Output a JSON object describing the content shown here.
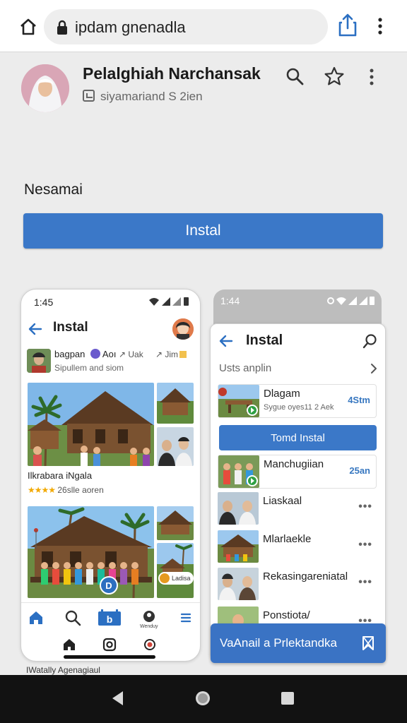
{
  "browser": {
    "url": "ipdam gnenadla",
    "icons": {
      "home": "home-icon",
      "lock": "lock-icon",
      "share": "share-icon",
      "more": "more-vert-icon"
    }
  },
  "header": {
    "title": "Pelalghiah Narchansak",
    "subtitle": "siyamariand S 2ien",
    "icons": {
      "search": "search-icon",
      "star": "star-icon",
      "more": "more-vert-icon"
    }
  },
  "main": {
    "label": "Nesamai",
    "install_button": "Instal"
  },
  "left_phone": {
    "time": "1:45",
    "title": "Instal",
    "profile_name": "bagpan",
    "profile_tag": "Aoı",
    "profile_sub": "Sipullem and siom",
    "action_1": "Uak",
    "action_2": "Jim",
    "caption_title": "Ilkrabara iNgala",
    "caption_stars": "★★★★",
    "caption_meta": "26slle aoren",
    "play_badge": "D",
    "small_badge": "Ladisa",
    "nav_label": "Wenduy"
  },
  "right_phone": {
    "time": "1:44",
    "title": "Instal",
    "section": "Usts anplin",
    "install_button": "Tomd Instal",
    "items": [
      {
        "name": "Dlagam",
        "sub": "Sygue oyes11 2 Aek",
        "tag": "4Stm"
      },
      {
        "name": "Manchugiian",
        "tag": "25an"
      },
      {
        "name": "Liaskaal",
        "more": "•••"
      },
      {
        "name": "Mlarlaekle",
        "more": "•••"
      },
      {
        "name": "Rekasingareniatal",
        "more": "•••"
      },
      {
        "name": "Ponstiota/",
        "more": "•••"
      }
    ]
  },
  "banner": {
    "text": "VaAnail a Prlektandka"
  },
  "footer": {
    "text": "IWatally Agenagiaul"
  },
  "colors": {
    "accent": "#3b78c8",
    "tag_blue": "#3777c0",
    "background": "#ececec"
  }
}
